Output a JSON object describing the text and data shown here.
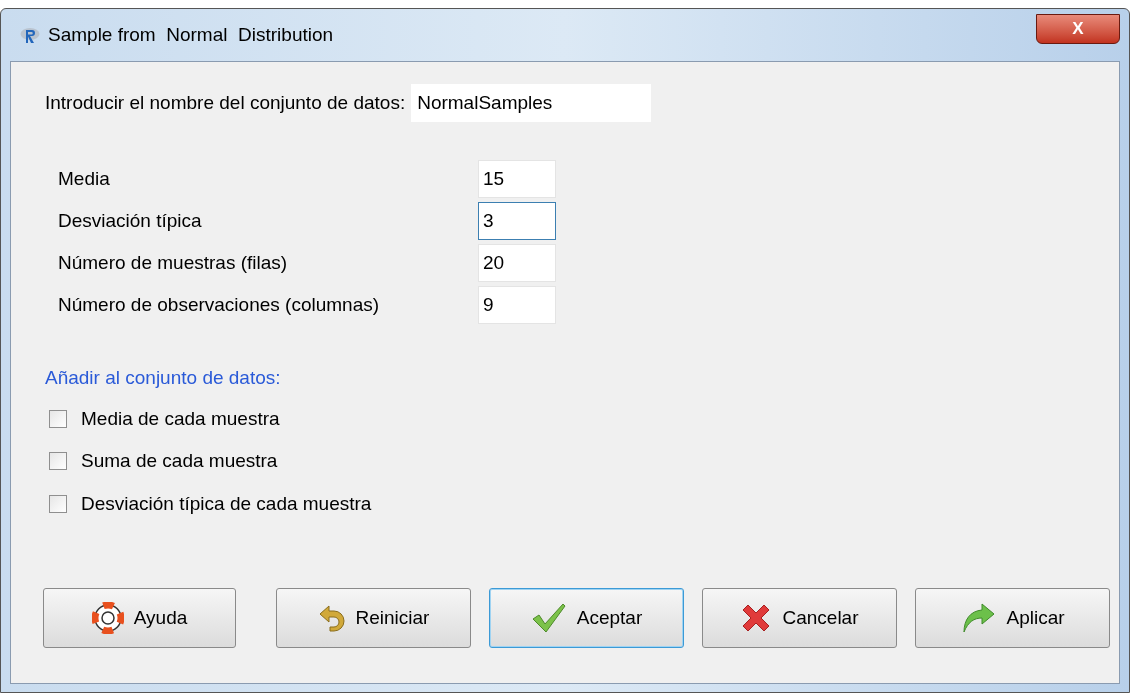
{
  "window": {
    "title": "Sample from  Normal  Distribution",
    "close": "X"
  },
  "dataset": {
    "label": "Introducir el nombre del conjunto de datos:",
    "value": "NormalSamples"
  },
  "parameters": [
    {
      "label": "Media",
      "value": "15",
      "focused": false
    },
    {
      "label": "Desviación típica",
      "value": "3",
      "focused": true
    },
    {
      "label": "Número de muestras (filas)",
      "value": "20",
      "focused": false
    },
    {
      "label": "Número de observaciones (columnas)",
      "value": "9",
      "focused": false
    }
  ],
  "add_section": {
    "title": "Añadir al conjunto de datos:",
    "options": [
      {
        "label": "Media de cada muestra",
        "checked": false
      },
      {
        "label": "Suma de cada muestra",
        "checked": false
      },
      {
        "label": "Desviación típica de cada muestra",
        "checked": false
      }
    ]
  },
  "buttons": [
    {
      "label": "Ayuda",
      "kind": "help",
      "focused": false
    },
    {
      "label": "Reiniciar",
      "kind": "reset",
      "focused": false
    },
    {
      "label": "Aceptar",
      "kind": "ok",
      "focused": true
    },
    {
      "label": "Cancelar",
      "kind": "cancel",
      "focused": false
    },
    {
      "label": "Aplicar",
      "kind": "apply",
      "focused": false
    }
  ]
}
